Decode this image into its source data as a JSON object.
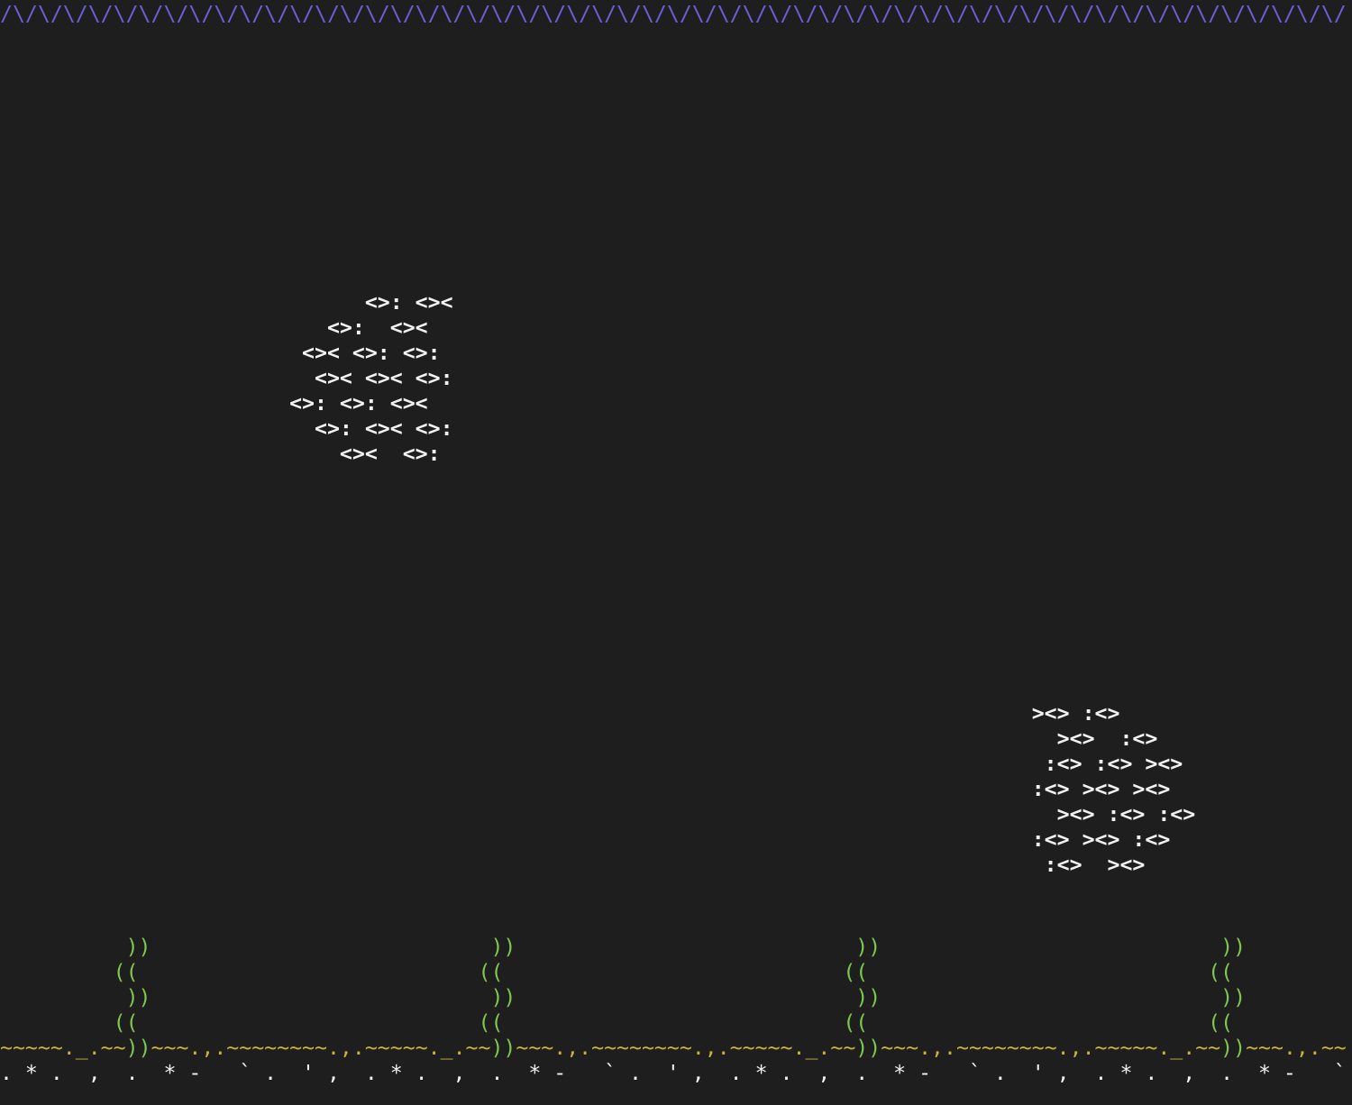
{
  "scene": {
    "surface_line": "/\\/\\/\\/\\/\\/\\/\\/\\/\\/\\/\\/\\/\\/\\/\\/\\/\\/\\/\\/\\/\\/\\/\\/\\/\\/\\/\\/\\/\\/\\/\\/\\/\\/\\/\\/\\/\\/\\/\\/\\/\\/\\/\\/\\/\\/\\/\\/\\/\\/\\/\\/\\/\\/",
    "school_left": "                             <>: <><\n                          <>:  <><\n                        <>< <>: <>:\n                         <>< <>< <>:\n                       <>: <>: <><\n                         <>: <>< <>:\n                           <><  <>:",
    "school_right": "                                                                                  ><> :<>\n                                                                                    ><>  :<>\n                                                                                   :<> :<> ><>\n                                                                                  :<> ><> ><>\n                                                                                    ><> :<> :<>\n                                                                                  :<> ><> :<>\n                                                                                   :<>  ><>",
    "weeds": "          ))                           ))                           ))                           ))\n         ((                           ((                           ((                           ((\n          ))                           ))                           ))                           ))\n         ((                           ((                           ((                           ((",
    "seabed_line": "~~~~~._.~~))~~~.,.~~~~~~~~.,.~~~~~._.~~))~~~.,.~~~~~~~~.,.~~~~~._.~~))~~~.,.~~~~~~~~.,.~~~~~._.~~))~~~.,.~~",
    "sand_line": ". * .  ,  .  * -   ` .  ' ,  . * .  ,  .  * -   ` .  ' ,  . * .  ,  .  * -   ` .  ' ,  . * .  ,  .  * -   `"
  },
  "colors": {
    "background": "#1e1e1e",
    "surface": "#6a5fd8",
    "fish": "#f2f2f2",
    "weed": "#7ec850",
    "seabed": "#c8b23c",
    "sand": "#f2f2f2"
  }
}
